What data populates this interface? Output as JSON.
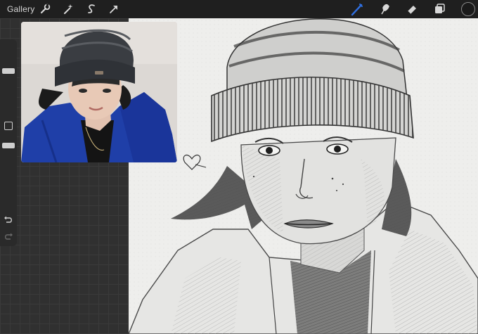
{
  "toolbar": {
    "gallery_label": "Gallery",
    "left_icons": [
      "wrench-icon",
      "magic-wand-icon",
      "selection-icon",
      "transform-arrow-icon"
    ],
    "right_icons": [
      "brush-icon",
      "smudge-icon",
      "eraser-icon",
      "layers-icon",
      "color-swatch"
    ],
    "active_tool": "brush-icon",
    "accent_color": "#2f6fe0",
    "current_color": "#1a1a1a"
  },
  "sidebar": {
    "controls": [
      "brush-size-slider",
      "modify-button",
      "opacity-slider",
      "undo-icon",
      "redo-icon"
    ]
  },
  "reference": {
    "description_icon": "reference-photo"
  },
  "canvas": {
    "annotation_mark": "heart-doodle"
  }
}
